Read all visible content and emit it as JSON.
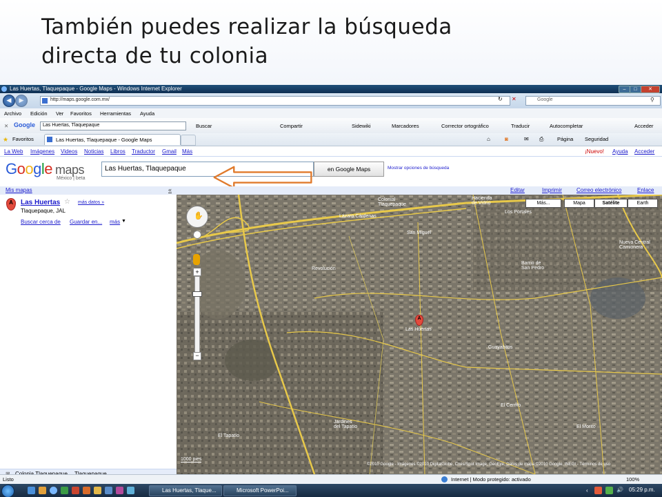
{
  "slide": {
    "title": "También puedes realizar la búsqueda\ndirecta de tu colonia"
  },
  "browser": {
    "window_title": "Las Huertas, Tlaquepaque - Google Maps - Windows Internet Explorer",
    "address": "http://maps.google.com.mx/",
    "search_placeholder": "Google",
    "menu": [
      "Archivo",
      "Edición",
      "Ver",
      "Favoritos",
      "Herramientas",
      "Ayuda"
    ],
    "toolbar": {
      "brand": "Google",
      "query": "Las Huertas, Tlaquepaque",
      "buscar": "Buscar",
      "compartir": "Compartir",
      "sidewiki": "Sidewiki",
      "marcadores": "Marcadores",
      "corrector": "Corrector ortográfico",
      "traducir": "Traducir",
      "autocompletar": "Autocompletar",
      "acceder": "Acceder"
    },
    "favorites_label": "Favoritos",
    "tab_title": "Las Huertas, Tlaquepaque - Google Maps",
    "cmd": {
      "pagina": "Página",
      "seguridad": "Seguridad"
    },
    "status": {
      "left": "Listo",
      "zone": "Internet | Modo protegido: activado",
      "zoom": "100%"
    }
  },
  "gmaps": {
    "top_links": [
      "La Web",
      "Imágenes",
      "Videos",
      "Noticias",
      "Libros",
      "Traductor",
      "Gmail",
      "Más"
    ],
    "top_right": {
      "nuevo": "¡Nuevo!",
      "ayuda": "Ayuda",
      "acceder": "Acceder"
    },
    "logo_maps": "maps",
    "logo_sub": "México | beta",
    "query": "Las Huertas, Tlaquepaque",
    "search_button": "en Google Maps",
    "more_options": "Mostrar opciones de búsqueda",
    "mis_mapas": "Mis mapas",
    "result": {
      "marker": "A",
      "title": "Las Huertas",
      "more": "más datos »",
      "address": "Tlaquepaque, JAL",
      "buscar_cerca": "Buscar cerca de",
      "guardar": "Guardar en...",
      "mas": "más"
    },
    "footer": {
      "colonia": "Colonia Tlaquepaque...",
      "tlaquepaque": "Tlaquepaque"
    },
    "map_links": [
      "Editar",
      "Imprimir",
      "Correo electrónico",
      "Enlace"
    ],
    "map_types": [
      "Más...",
      "Mapa",
      "Satélite",
      "Earth"
    ],
    "map_labels": {
      "colonial": "Colonial\nTlaquepaque",
      "lazaro": "Lázaro Cárdenas",
      "hacienda": "Hacienda\nde Vidrio",
      "portales": "Los Portales",
      "san_miguel": "San Miguel",
      "san_pedro": "Barrio de\nSan Pedro",
      "nueva_central": "Nueva Central\nCamionera",
      "revolucion": "Revolución",
      "marker_label": "Las Huertas",
      "guayabitos": "Guayabitos",
      "el_cerrito": "El Cerrito",
      "el_morito": "El Morito",
      "tapatio": "El Tapatío",
      "jardines": "Jardines\ndel Tapatío",
      "copyright": "©2010 Google - Imágenes ©2010 DigitalGlobe, Cnes/Spot Image, GeoEye, Datos de mapa ©2010 Google, INEGI - Términos de uso"
    },
    "scale": "1000 pies"
  },
  "taskbar": {
    "items": [
      "Las Huertas, Tlaque...",
      "Microsoft PowerPoi..."
    ],
    "clock": "05:29 p.m."
  },
  "colors": {
    "ie_titlebar": "#1f4f7a",
    "link": "#1a1acc",
    "arrow": "#e07a2c",
    "marker": "#e24b3d"
  }
}
